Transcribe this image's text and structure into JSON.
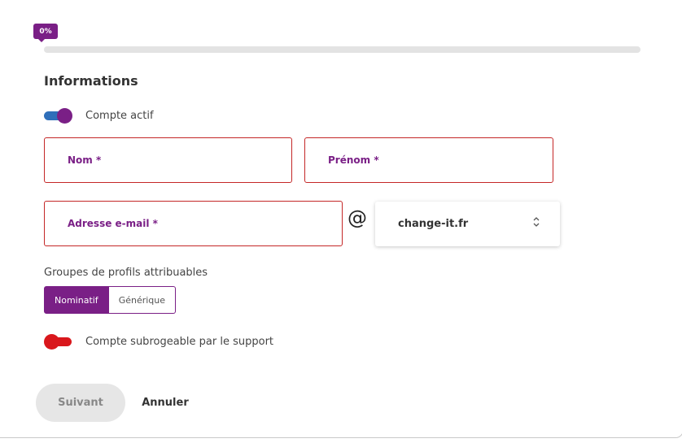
{
  "progress": {
    "badge": "0%",
    "fraction": 0
  },
  "section": {
    "title": "Informations"
  },
  "account_active": {
    "label": "Compte actif",
    "on": true
  },
  "fields": {
    "last_name": {
      "label": "Nom *"
    },
    "first_name": {
      "label": "Prénom *"
    },
    "email": {
      "label": "Adresse e-mail *",
      "separator": "@"
    }
  },
  "domain_select": {
    "value": "change-it.fr",
    "icon": "chevron-up-down-icon"
  },
  "profile_groups": {
    "label": "Groupes de profils attribuables",
    "options": [
      "Nominatif",
      "Générique"
    ],
    "selected": "Nominatif"
  },
  "support_subrogation": {
    "label": "Compte subrogeable par le support",
    "on": false
  },
  "actions": {
    "next": "Suivant",
    "cancel": "Annuler"
  },
  "colors": {
    "accent": "#7a1f86",
    "error": "#c42727",
    "toggle_off": "#d9171c",
    "toggle_track_on": "#2f6fba"
  }
}
